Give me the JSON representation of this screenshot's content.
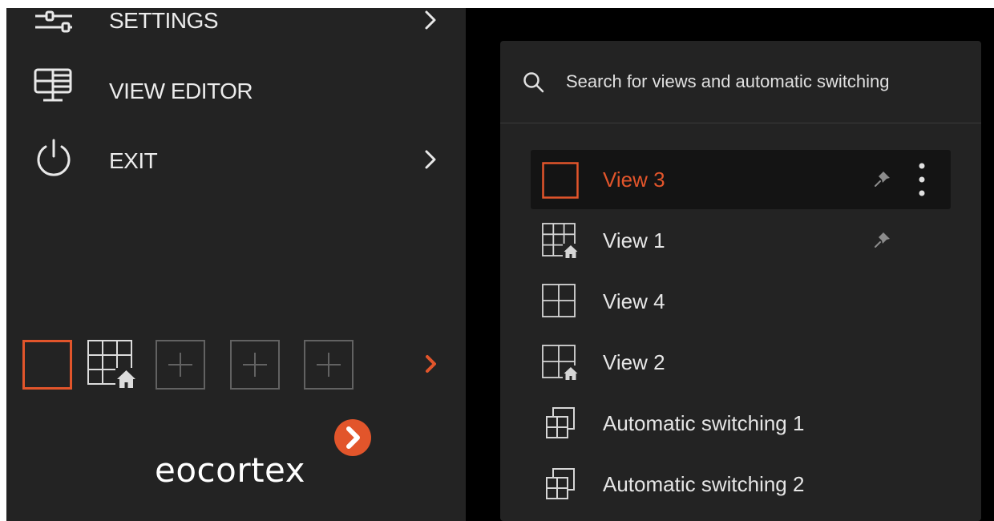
{
  "colors": {
    "accent": "#e2552b",
    "panel_bg": "#232323",
    "background": "#000000",
    "text": "#ececec"
  },
  "menu": {
    "items": [
      {
        "label": "SETTINGS",
        "icon": "sliders-icon",
        "has_submenu": true
      },
      {
        "label": "VIEW EDITOR",
        "icon": "monitor-grid-icon",
        "has_submenu": false
      },
      {
        "label": "EXIT",
        "icon": "power-icon",
        "has_submenu": true
      }
    ]
  },
  "view_strip": {
    "slots": [
      {
        "type": "single-view",
        "active": true
      },
      {
        "type": "grid-home-view",
        "active": false
      },
      {
        "type": "add",
        "active": false
      },
      {
        "type": "add",
        "active": false
      },
      {
        "type": "add",
        "active": false
      }
    ],
    "next_icon": "chevron-right-icon"
  },
  "logo": {
    "text": "eocortex"
  },
  "views_popup": {
    "search_placeholder": "Search for views and automatic switching",
    "items": [
      {
        "label": "View 3",
        "icon": "single-view-icon",
        "selected": true,
        "pinned": true
      },
      {
        "label": "View 1",
        "icon": "grid-3x3-home-icon",
        "selected": false,
        "pinned": true
      },
      {
        "label": "View 4",
        "icon": "grid-2x2-icon",
        "selected": false,
        "pinned": false
      },
      {
        "label": "View 2",
        "icon": "grid-2x2-home-icon",
        "selected": false,
        "pinned": false
      },
      {
        "label": "Automatic switching 1",
        "icon": "auto-switch-icon",
        "selected": false,
        "pinned": false
      },
      {
        "label": "Automatic switching 2",
        "icon": "auto-switch-icon",
        "selected": false,
        "pinned": false
      }
    ]
  }
}
